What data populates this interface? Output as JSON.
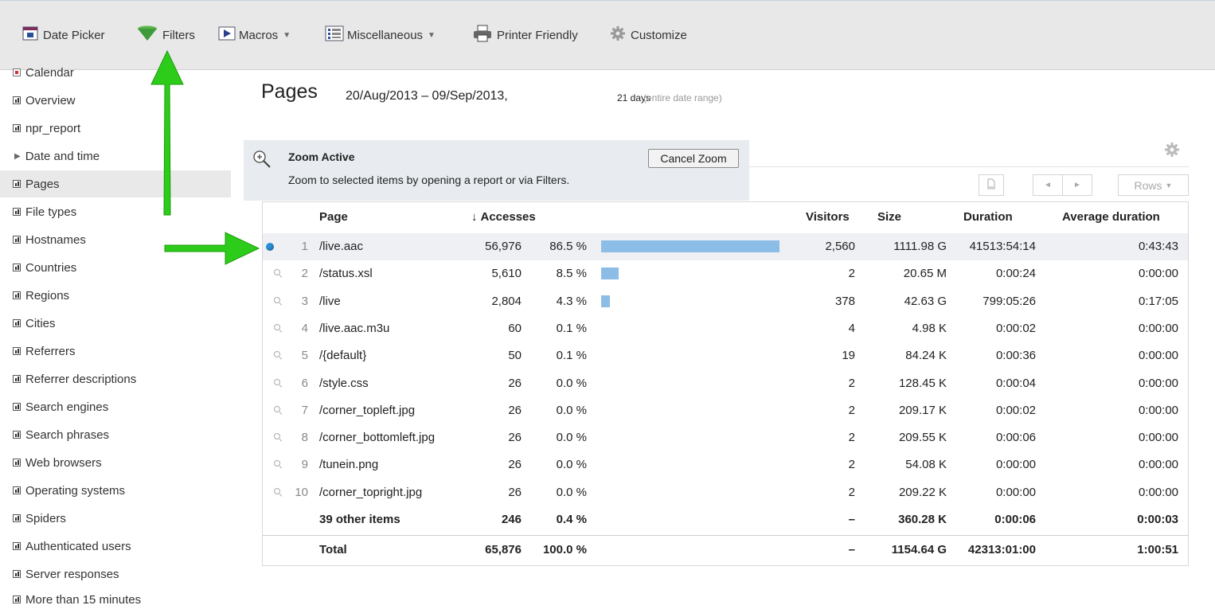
{
  "toolbar": {
    "items": [
      {
        "label": "Date Picker",
        "icon": "calendar-icon"
      },
      {
        "label": "Filters",
        "icon": "funnel-icon"
      },
      {
        "label": "Macros",
        "icon": "play-icon",
        "dropdown": true
      },
      {
        "label": "Miscellaneous",
        "icon": "list-icon",
        "dropdown": true
      },
      {
        "label": "Printer Friendly",
        "icon": "printer-icon"
      },
      {
        "label": "Customize",
        "icon": "gear-icon"
      }
    ]
  },
  "sidebar": {
    "items": [
      {
        "label": "Calendar",
        "icon": "calendar-icon"
      },
      {
        "label": "Overview",
        "icon": "bar-chart-icon"
      },
      {
        "label": "npr_report",
        "icon": "bar-chart-icon"
      },
      {
        "label": "Date and time",
        "icon": "triangle-right-icon"
      },
      {
        "label": "Pages",
        "icon": "bar-chart-icon",
        "active": true
      },
      {
        "label": "File types",
        "icon": "bar-chart-icon"
      },
      {
        "label": "Hostnames",
        "icon": "bar-chart-icon"
      },
      {
        "label": "Countries",
        "icon": "bar-chart-icon"
      },
      {
        "label": "Regions",
        "icon": "bar-chart-icon"
      },
      {
        "label": "Cities",
        "icon": "bar-chart-icon"
      },
      {
        "label": "Referrers",
        "icon": "bar-chart-icon"
      },
      {
        "label": "Referrer descriptions",
        "icon": "bar-chart-icon"
      },
      {
        "label": "Search engines",
        "icon": "bar-chart-icon"
      },
      {
        "label": "Search phrases",
        "icon": "bar-chart-icon"
      },
      {
        "label": "Web browsers",
        "icon": "bar-chart-icon"
      },
      {
        "label": "Operating systems",
        "icon": "bar-chart-icon"
      },
      {
        "label": "Spiders",
        "icon": "bar-chart-icon"
      },
      {
        "label": "Authenticated users",
        "icon": "bar-chart-icon"
      },
      {
        "label": "Server responses",
        "icon": "bar-chart-icon"
      },
      {
        "label": "More than 15 minutes",
        "icon": "bar-chart-icon"
      }
    ]
  },
  "header": {
    "title": "Pages",
    "date_range": "20/Aug/2013 – 09/Sep/2013,",
    "days": "21 days",
    "range_note": "(entire date range)"
  },
  "zoom": {
    "title": "Zoom Active",
    "description": "Zoom to selected items by opening a report or via Filters.",
    "cancel_label": "Cancel Zoom"
  },
  "pager": {
    "rows_label": "Rows",
    "prev": "◄",
    "next": "►"
  },
  "table": {
    "columns": {
      "page": "Page",
      "accesses": "Accesses",
      "visitors": "Visitors",
      "size": "Size",
      "duration": "Duration",
      "avg_duration": "Average duration"
    },
    "rows": [
      {
        "num": "1",
        "page": "/live.aac",
        "accesses": "56,976",
        "percent": "86.5 %",
        "share": 0.865,
        "visitors": "2,560",
        "size": "1111.98 G",
        "duration": "41513:54:14",
        "avg": "0:43:43",
        "selected": true
      },
      {
        "num": "2",
        "page": "/status.xsl",
        "accesses": "5,610",
        "percent": "8.5 %",
        "share": 0.085,
        "visitors": "2",
        "size": "20.65 M",
        "duration": "0:00:24",
        "avg": "0:00:00"
      },
      {
        "num": "3",
        "page": "/live",
        "accesses": "2,804",
        "percent": "4.3 %",
        "share": 0.043,
        "visitors": "378",
        "size": "42.63 G",
        "duration": "799:05:26",
        "avg": "0:17:05"
      },
      {
        "num": "4",
        "page": "/live.aac.m3u",
        "accesses": "60",
        "percent": "0.1 %",
        "share": 0.001,
        "visitors": "4",
        "size": "4.98 K",
        "duration": "0:00:02",
        "avg": "0:00:00"
      },
      {
        "num": "5",
        "page": "/{default}",
        "accesses": "50",
        "percent": "0.1 %",
        "share": 0.001,
        "visitors": "19",
        "size": "84.24 K",
        "duration": "0:00:36",
        "avg": "0:00:00"
      },
      {
        "num": "6",
        "page": "/style.css",
        "accesses": "26",
        "percent": "0.0 %",
        "share": 0,
        "visitors": "2",
        "size": "128.45 K",
        "duration": "0:00:04",
        "avg": "0:00:00"
      },
      {
        "num": "7",
        "page": "/corner_topleft.jpg",
        "accesses": "26",
        "percent": "0.0 %",
        "share": 0,
        "visitors": "2",
        "size": "209.17 K",
        "duration": "0:00:02",
        "avg": "0:00:00"
      },
      {
        "num": "8",
        "page": "/corner_bottomleft.jpg",
        "accesses": "26",
        "percent": "0.0 %",
        "share": 0,
        "visitors": "2",
        "size": "209.55 K",
        "duration": "0:00:06",
        "avg": "0:00:00"
      },
      {
        "num": "9",
        "page": "/tunein.png",
        "accesses": "26",
        "percent": "0.0 %",
        "share": 0,
        "visitors": "2",
        "size": "54.08 K",
        "duration": "0:00:00",
        "avg": "0:00:00"
      },
      {
        "num": "10",
        "page": "/corner_topright.jpg",
        "accesses": "26",
        "percent": "0.0 %",
        "share": 0,
        "visitors": "2",
        "size": "209.22 K",
        "duration": "0:00:00",
        "avg": "0:00:00"
      }
    ],
    "other": {
      "page": "39 other items",
      "accesses": "246",
      "percent": "0.4 %",
      "visitors": "–",
      "size": "360.28 K",
      "duration": "0:00:06",
      "avg": "0:00:03"
    },
    "total": {
      "page": "Total",
      "accesses": "65,876",
      "percent": "100.0 %",
      "visitors": "–",
      "size": "1154.64 G",
      "duration": "42313:01:00",
      "avg": "1:00:51"
    }
  },
  "colors": {
    "bar": "#8cbde6",
    "annotation_arrow": "#2ecc1a",
    "selected_dot": "#2b8fd6"
  }
}
